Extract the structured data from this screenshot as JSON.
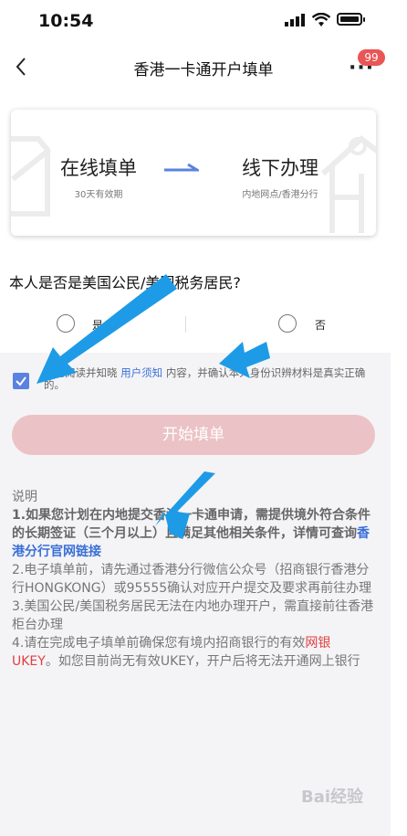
{
  "status_bar": {
    "time": "10:54"
  },
  "nav": {
    "title": "香港一卡通开户填单",
    "more_label": "···",
    "badge_count": "99"
  },
  "card": {
    "step1": {
      "title": "在线填单",
      "subtitle": "30天有效期"
    },
    "step2": {
      "title": "线下办理",
      "subtitle": "内地网点/香港分行"
    }
  },
  "question": {
    "text": "本人是否是美国公民/美国税务居民?",
    "options": [
      {
        "label": "是"
      },
      {
        "label": "否"
      }
    ]
  },
  "agreement": {
    "checked": true,
    "prefix": "我已阅读并知晓",
    "link": "用户须知",
    "suffix": "内容，并确认本人身份识辨材料是真实正确的。"
  },
  "start_button": {
    "label": "开始填单"
  },
  "notes": {
    "heading": "说明",
    "item1": {
      "text": "1.如果您计划在内地提交香港一卡通申请，需提供境外符合条件的长期签证（三个月以上）且满足其他相关条件，详情可查询",
      "link": "香港分行官网链接"
    },
    "item2": "2.电子填单前，请先通过香港分行微信公众号（招商银行香港分行HONGKONG）或95555确认对应开户提交及要求再前往办理",
    "item3": "3.美国公民/美国税务居民无法在内地办理开户，需直接前往香港柜台办理",
    "item4": {
      "prefix": "4.请在完成电子填单前确保您有境内招商银行的有效",
      "highlight": "网银UKEY",
      "suffix": "。如您目前尚无有效UKEY，开户后将无法开通网上银行"
    }
  },
  "watermark": "Bai经验",
  "colors": {
    "accent_blue": "#3b6fd8",
    "button_pink": "#ebc2c5",
    "badge_red": "#ea5555",
    "annotation_blue": "#1e9be6"
  }
}
